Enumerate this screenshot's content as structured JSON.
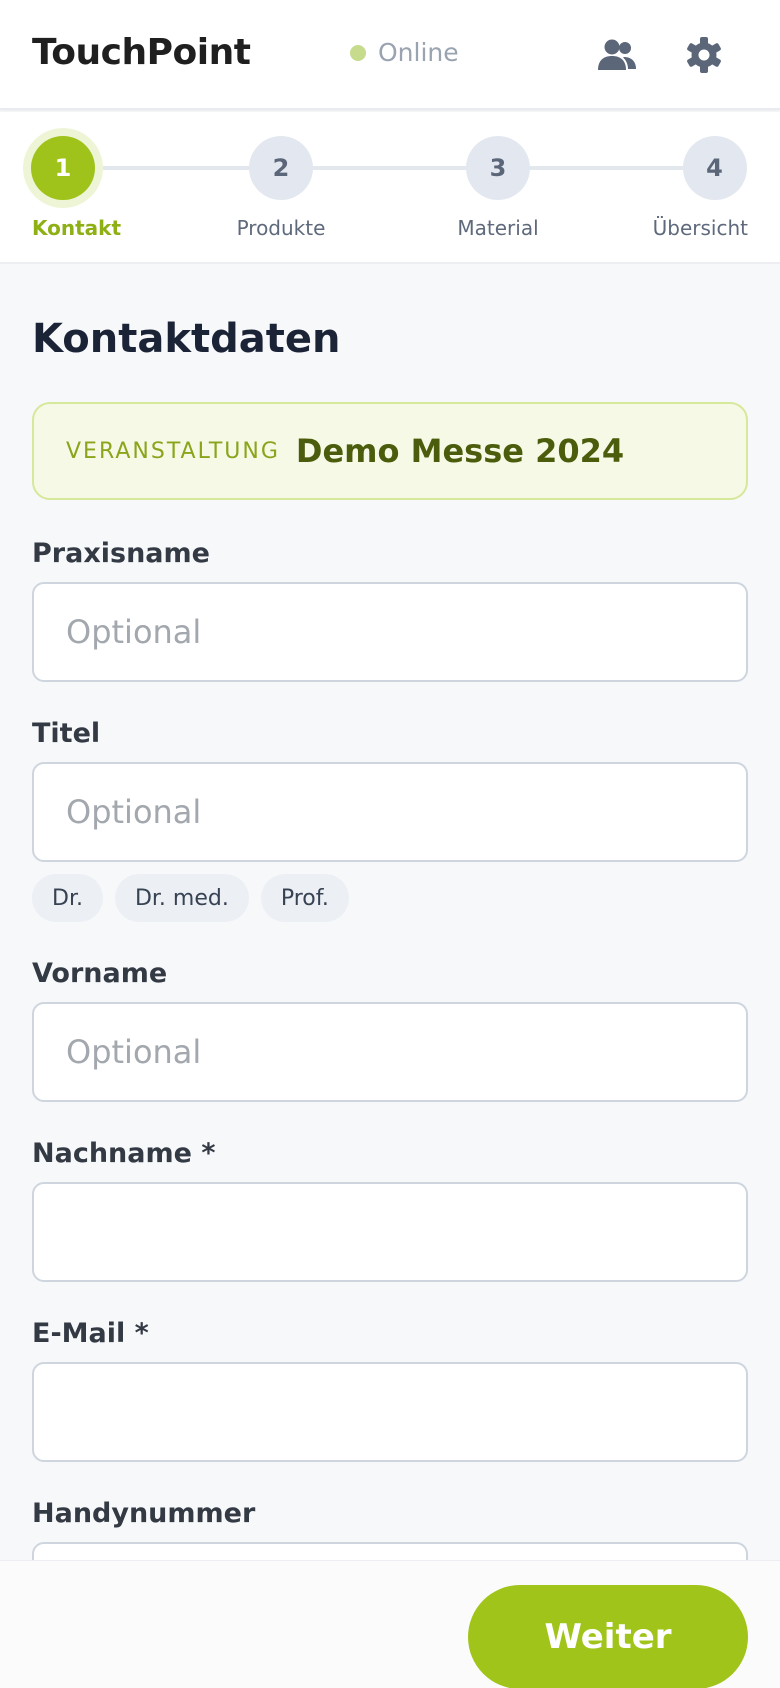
{
  "header": {
    "title": "TouchPoint",
    "status": "Online",
    "status_color": "#c6dc8c",
    "icons": [
      "users-icon",
      "gear-icon"
    ]
  },
  "stepper": {
    "accent_color": "#9fc31a",
    "steps": [
      {
        "number": "1",
        "label": "Kontakt",
        "active": true
      },
      {
        "number": "2",
        "label": "Produkte",
        "active": false
      },
      {
        "number": "3",
        "label": "Material",
        "active": false
      },
      {
        "number": "4",
        "label": "Übersicht",
        "active": false
      }
    ]
  },
  "main": {
    "title": "Kontaktdaten",
    "event": {
      "label": "VERANSTALTUNG",
      "name": "Demo Messe 2024"
    },
    "fields": {
      "praxisname": {
        "label": "Praxisname",
        "placeholder": "Optional",
        "value": ""
      },
      "titel": {
        "label": "Titel",
        "placeholder": "Optional",
        "value": ""
      },
      "vorname": {
        "label": "Vorname",
        "placeholder": "Optional",
        "value": ""
      },
      "nachname": {
        "label": "Nachname *",
        "placeholder": "",
        "value": ""
      },
      "email": {
        "label": "E-Mail *",
        "placeholder": "",
        "value": ""
      },
      "handy": {
        "label": "Handynummer",
        "placeholder": "",
        "value": ""
      }
    },
    "title_chips": [
      "Dr.",
      "Dr. med.",
      "Prof."
    ]
  },
  "footer": {
    "next_label": "Weiter"
  }
}
